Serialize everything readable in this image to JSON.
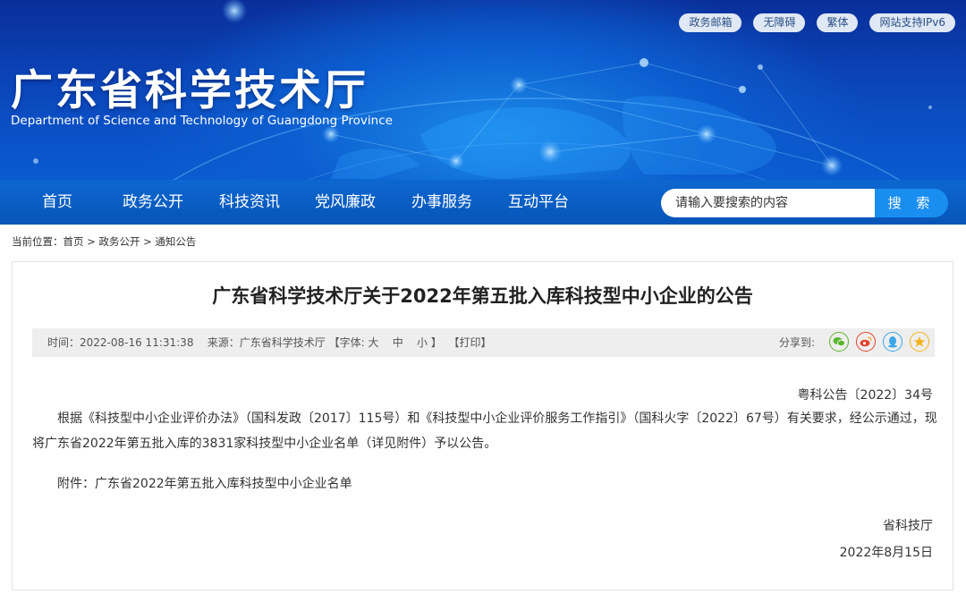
{
  "header": {
    "top_links": [
      "政务邮箱",
      "无障碍",
      "繁体",
      "网站支持IPv6"
    ],
    "title": "广东省科学技术厅",
    "subtitle": "Department of Science and Technology of Guangdong Province"
  },
  "nav": {
    "items": [
      "首页",
      "政务公开",
      "科技资讯",
      "党风廉政",
      "办事服务",
      "互动平台"
    ],
    "search_placeholder": "请输入要搜索的内容",
    "search_button": "搜 索"
  },
  "breadcrumb": {
    "prefix": "当前位置：",
    "items": [
      "首页",
      "政务公开",
      "通知公告"
    ],
    "separator": " > "
  },
  "article": {
    "title": "广东省科学技术厅关于2022年第五批入库科技型中小企业的公告",
    "meta": {
      "time": "时间：2022-08-16 11:31:38",
      "source": "来源：广东省科学技术厅",
      "font_label": "【字体:",
      "font_sizes": [
        "大",
        "中",
        "小"
      ],
      "font_close": "】",
      "print": "【打印】",
      "share_label": "分享到:"
    },
    "doc_number": "粤科公告〔2022〕34号",
    "body": "根据《科技型中小企业评价办法》（国科发政〔2017〕115号）和《科技型中小企业评价服务工作指引》（国科火字〔2022〕67号）有关要求，经公示通过，现将广东省2022年第五批入库的3831家科技型中小企业名单（详见附件）予以公告。",
    "attachment": "附件：广东省2022年第五批入库科技型中小企业名单",
    "signature": "省科技厅",
    "date": "2022年8月15日"
  },
  "colors": {
    "nav_bg": "#0b5fc6",
    "search_button": "#1a8ef0",
    "wechat": "#5cb531",
    "weibo": "#e6412f",
    "qq": "#3aa6e8",
    "qzone": "#f5b31b"
  },
  "icons": [
    "wechat-icon",
    "weibo-icon",
    "qq-icon",
    "qzone-icon"
  ]
}
